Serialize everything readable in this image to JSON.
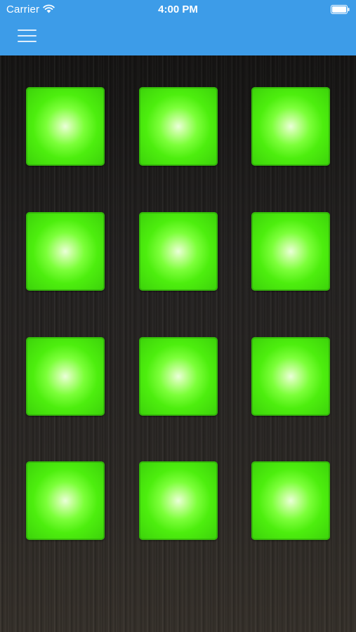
{
  "status_bar": {
    "carrier": "Carrier",
    "time": "4:00 PM",
    "wifi_icon": "wifi-icon",
    "battery_icon": "battery-icon"
  },
  "nav_bar": {
    "menu_icon": "hamburger-menu-icon",
    "color": "#3d9ce8"
  },
  "pads": {
    "rows": 4,
    "columns": 3,
    "color": "#4dee0e",
    "highlight_color": "#eaffd8",
    "items": [
      {
        "row": 1,
        "col": 1
      },
      {
        "row": 1,
        "col": 2
      },
      {
        "row": 1,
        "col": 3
      },
      {
        "row": 2,
        "col": 1
      },
      {
        "row": 2,
        "col": 2
      },
      {
        "row": 2,
        "col": 3
      },
      {
        "row": 3,
        "col": 1
      },
      {
        "row": 3,
        "col": 2
      },
      {
        "row": 3,
        "col": 3
      },
      {
        "row": 4,
        "col": 1
      },
      {
        "row": 4,
        "col": 2
      },
      {
        "row": 4,
        "col": 3
      }
    ]
  }
}
